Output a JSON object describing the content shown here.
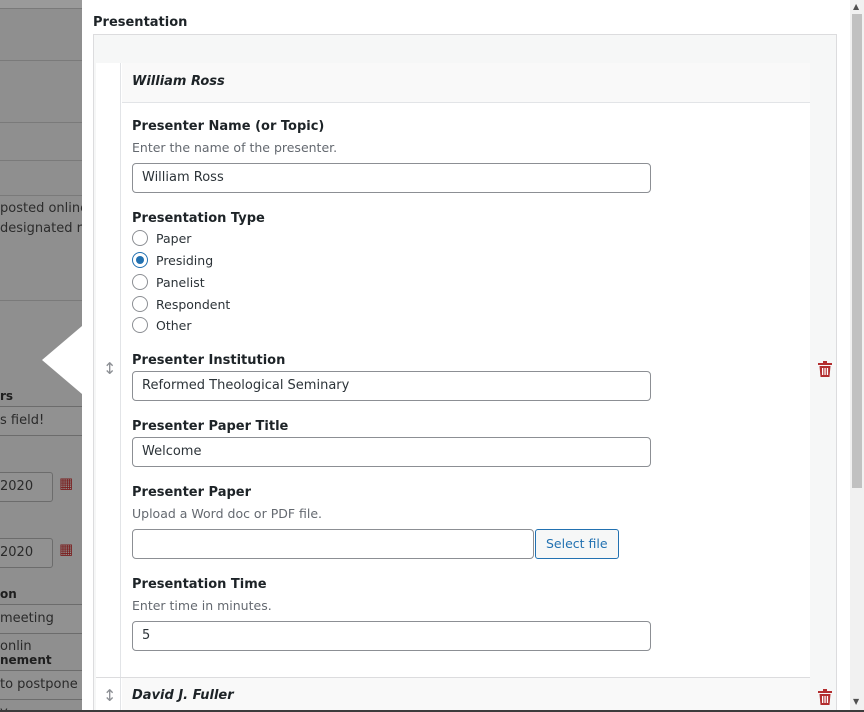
{
  "background": {
    "text_lines": [
      "posted online",
      "designated re"
    ],
    "section_labels": [
      "rs",
      "on",
      "nement"
    ],
    "field_hint": "s field!",
    "date_inputs": [
      "2020",
      "2020"
    ],
    "field_meeting": "meeting onlin",
    "field_postpone": "to postpone y"
  },
  "section": {
    "title": "Presentation"
  },
  "rows": [
    {
      "header": "William Ross",
      "name_label": "Presenter Name (or Topic)",
      "name_desc": "Enter the name of the presenter.",
      "name_value": "William Ross",
      "type_label": "Presentation Type",
      "types": [
        {
          "label": "Paper",
          "checked": false
        },
        {
          "label": "Presiding",
          "checked": true
        },
        {
          "label": "Panelist",
          "checked": false
        },
        {
          "label": "Respondent",
          "checked": false
        },
        {
          "label": "Other",
          "checked": false
        }
      ],
      "institution_label": "Presenter Institution",
      "institution_value": "Reformed Theological Seminary",
      "paper_title_label": "Presenter Paper Title",
      "paper_title_value": "Welcome",
      "paper_label": "Presenter Paper",
      "paper_desc": "Upload a Word doc or PDF file.",
      "select_file_label": "Select file",
      "time_label": "Presentation Time",
      "time_desc": "Enter time in minutes.",
      "time_value": "5"
    },
    {
      "header": "David J. Fuller"
    }
  ],
  "icons": {
    "drag": "drag-handle-icon",
    "delete": "trash-icon",
    "calendar": "calendar-icon"
  },
  "colors": {
    "accent": "#2271b1",
    "danger": "#b32d2e",
    "overlay": "#8c8c8c"
  }
}
